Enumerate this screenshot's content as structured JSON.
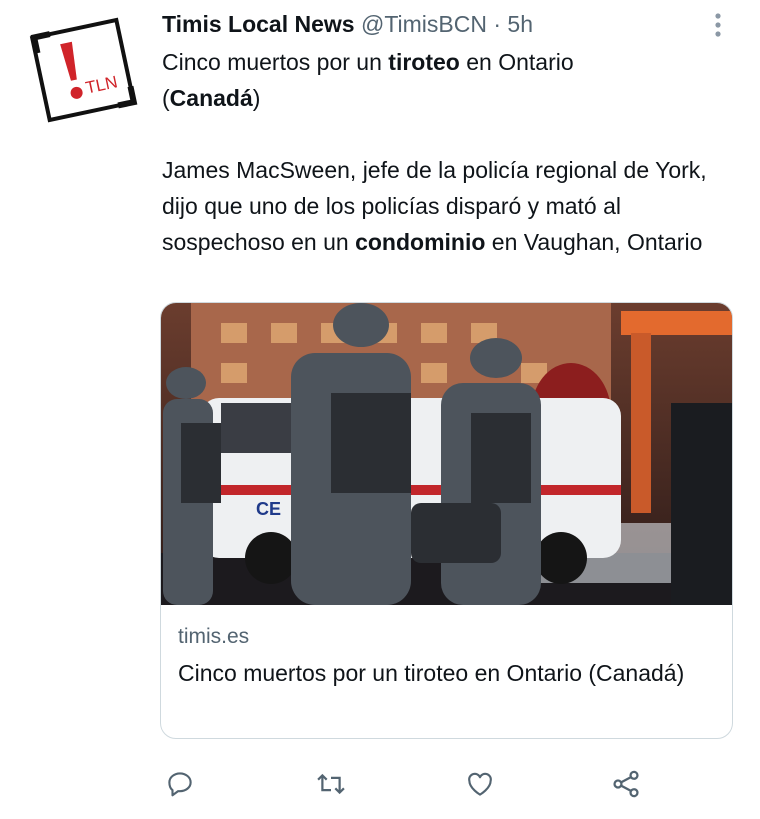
{
  "tweet": {
    "display_name": "Timis Local News",
    "handle": "@TimisBCN",
    "separator": "·",
    "time": "5h",
    "text": {
      "l1_pre": "Cinco muertos por un ",
      "l1_bold": "tiroteo",
      "l1_post": " en Ontario",
      "l2_open": "(",
      "l2_bold": "Canadá",
      "l2_close": ")",
      "p2_pre": "James MacSween, jefe de la policía regional de York, dijo que uno de los policías disparó y mató al sospechoso en un ",
      "p2_bold": "condominio",
      "p2_post": " en Vaughan, Ontario"
    },
    "avatar_text": "TLN"
  },
  "card": {
    "domain": "timis.es",
    "title": "Cinco muertos por un tiroteo en Ontario (Canadá)"
  },
  "icons": {
    "more": "more-icon",
    "reply": "reply-icon",
    "retweet": "retweet-icon",
    "like": "heart-icon",
    "share": "share-icon"
  },
  "colors": {
    "text": "#0f1419",
    "muted": "#536471",
    "logo_red": "#d0242a",
    "border": "#cfd9de"
  }
}
